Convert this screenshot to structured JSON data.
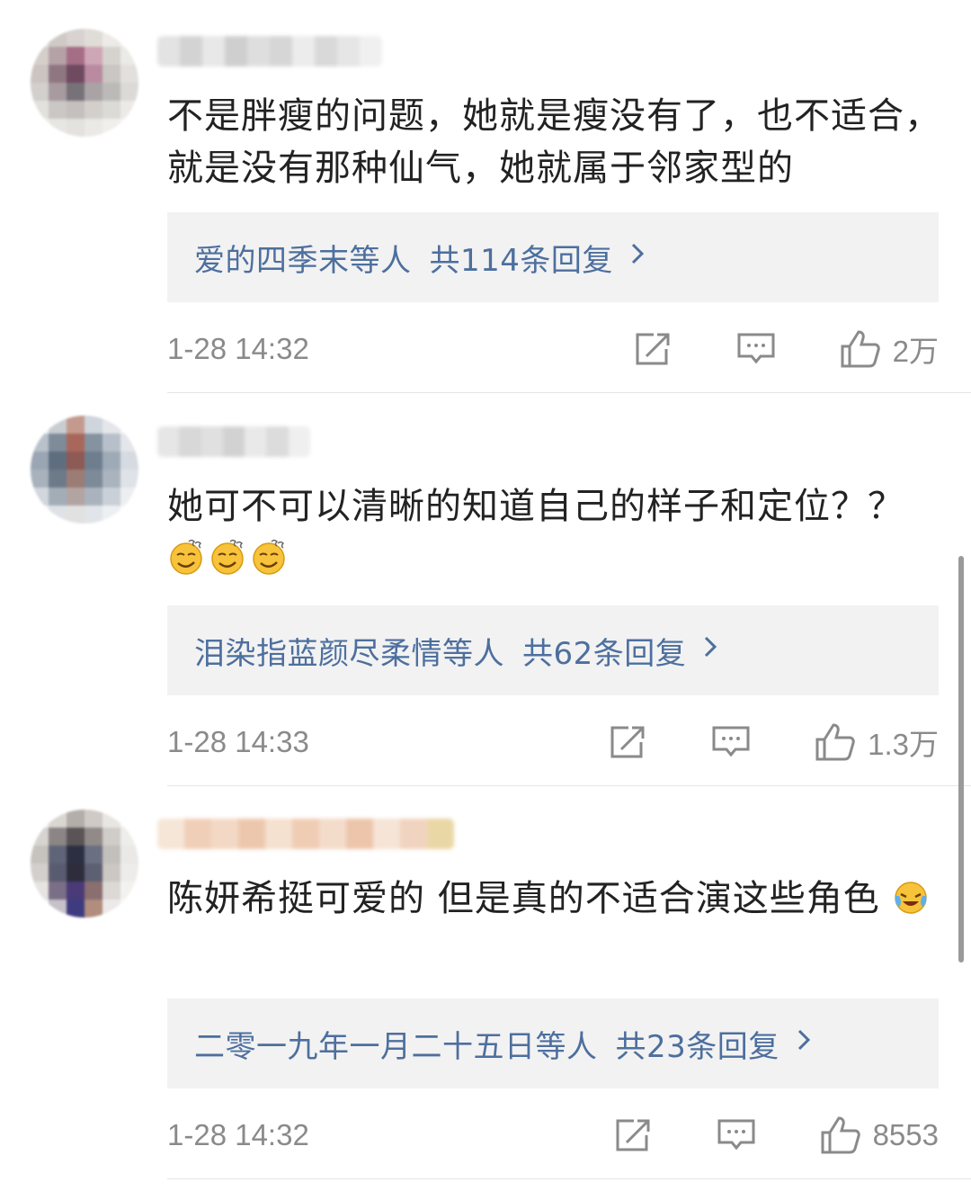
{
  "comments": [
    {
      "text": "不是胖瘦的问题，她就是瘦没有了，也不适合，就是没有那种仙气，她就属于邻家型的",
      "reply_names": "爱的四季末",
      "reply_etc": "等人",
      "reply_count": "共114条回复",
      "time": "1-28 14:32",
      "likes": "2万"
    },
    {
      "text": "她可不可以清晰的知道自己的样子和定位？？",
      "reply_names": "泪染指蓝颜尽柔情",
      "reply_etc": "等人",
      "reply_count": "共62条回复",
      "time": "1-28 14:33",
      "likes": "1.3万"
    },
    {
      "text": "陈妍希挺可爱的 但是真的不适合演这些角色",
      "reply_names": "二零一九年一月二十五日",
      "reply_etc": "等人",
      "reply_count": "共23条回复",
      "time": "1-28 14:32",
      "likes": "8553"
    }
  ],
  "icons": {
    "chevron": "chevron-right-icon",
    "repost": "share-icon",
    "comment": "comment-icon",
    "like": "thumbs-up-icon",
    "emoji_smirk": "smug-face-emoji",
    "emoji_cry": "crying-laughing-emoji"
  },
  "colors": {
    "link": "#4d6f9e",
    "meta": "#8a8a8a",
    "reply_bg": "#f2f2f2"
  }
}
